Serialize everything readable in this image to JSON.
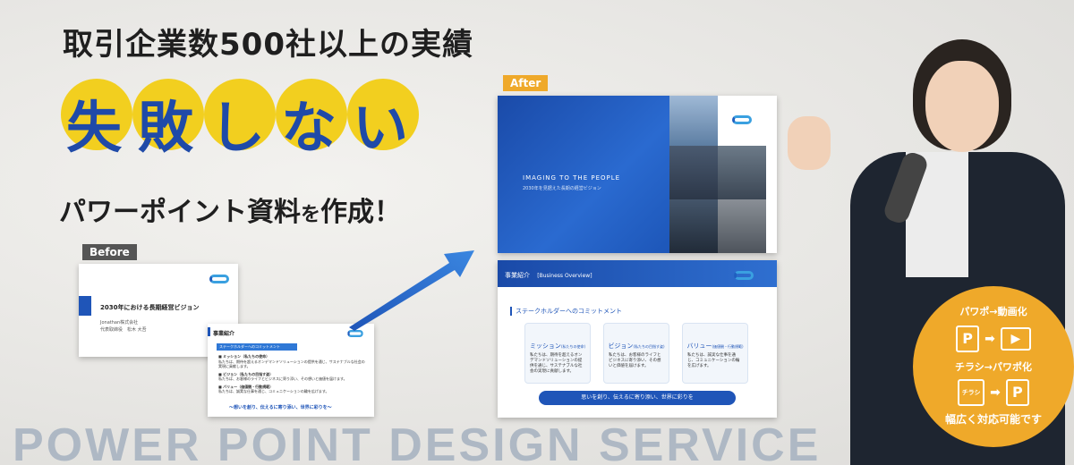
{
  "headline": {
    "line1": "取引企業数500社以上の実績",
    "big_chars": [
      "失",
      "敗",
      "し",
      "な",
      "い"
    ],
    "line3_main": "パワーポイント資料",
    "line3_small": "を",
    "line3_end": "作成！"
  },
  "labels": {
    "before": "Before",
    "after": "After"
  },
  "before_slide1": {
    "title": "2030年における長期経営ビジョン",
    "sub1": "Jonathan株式会社",
    "sub2": "代表取締役　松木 大吾"
  },
  "before_slide2": {
    "header": "事業紹介",
    "section": "ステークホルダーへのコミットメント",
    "items": [
      {
        "head": "■ ミッション（私たちの使命）",
        "body": "私たちは、期待を超えるオンデマンドソリューションの提供を通じ、サステナブルな社会の実現に貢献します。"
      },
      {
        "head": "■ ビジョン（私たちの目指す姿）",
        "body": "私たちは、お客様のライフとビジネスに寄り添い、その想いと価値を届けます。"
      },
      {
        "head": "■ バリュー（価値観・行動規範）",
        "body": "私たちは、誠実な仕事を通じ、コミュニケーションの輪を広げます。"
      }
    ],
    "footer": "〜想いを創り、伝えるに寄り添い、世界に彩りを〜"
  },
  "after_slide1": {
    "title": "IMAGING TO THE PEOPLE",
    "subtitle": "2030年を見据えた長期の経営ビジョン"
  },
  "after_slide2": {
    "header": "事業紹介",
    "header_en": "[Business Overview]",
    "section": "ステークホルダーへのコミットメント",
    "cards": [
      {
        "title": "ミッション",
        "note": "(私たちの使命)",
        "body": "私たちは、期待を超えるオンデマンドソリューションの提供を通じ、サステナブルな社会の実現に貢献します。"
      },
      {
        "title": "ビジョン",
        "note": "(私たちの目指す姿)",
        "body": "私たちは、お客様のライフとビジネスに寄り添い、その想いと価値を届けます。"
      },
      {
        "title": "バリュー",
        "note": "(価値観・行動規範)",
        "body": "私たちは、誠実な仕事を通じ、コミュニケーションの輪を広げます。"
      }
    ],
    "banner": "思いを創り、伝えるに寄り添い、世界に彩りを"
  },
  "badge": {
    "line1": "パワポ→動画化",
    "line2": "チラシ→パワポ化",
    "chirashi": "チラシ",
    "p": "P",
    "line3": "幅広く対応可能です"
  },
  "bottom_text": "POWER POINT DESIGN SERVICE",
  "colors": {
    "accent_blue": "#1f55b8",
    "highlight_yellow": "#f2cf1f",
    "badge_orange": "#efa92a"
  }
}
